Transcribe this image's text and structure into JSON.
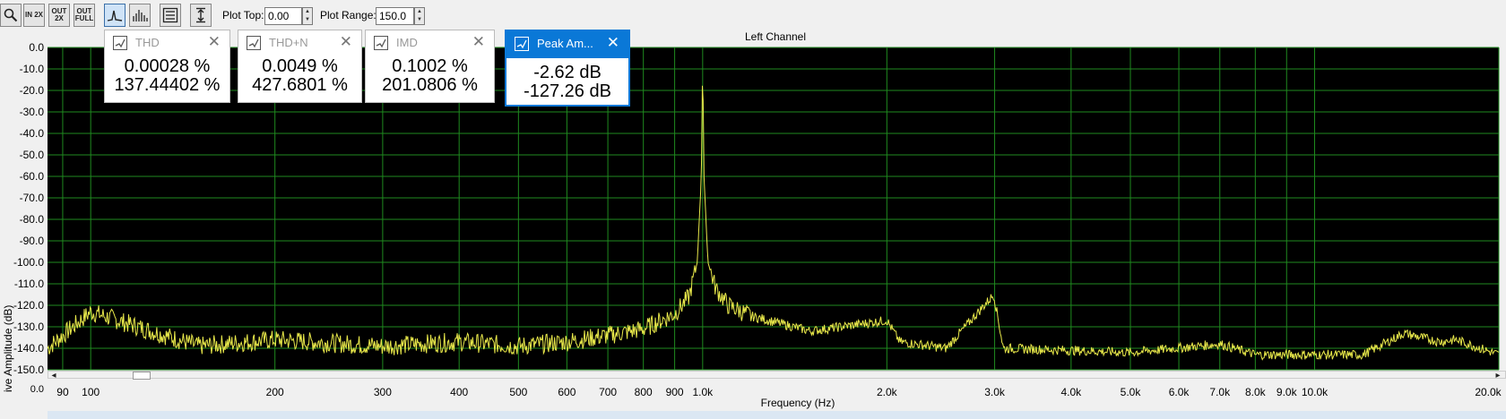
{
  "toolbar": {
    "buttons": [
      {
        "name": "zoom-button",
        "icon": "magnifier-icon",
        "label": ""
      },
      {
        "name": "zoom-in-2x-button",
        "icon": "zoom-in-2x-icon",
        "label": "IN 2X"
      },
      {
        "name": "zoom-out-2x-button",
        "icon": "zoom-out-2x-icon",
        "label": "OUT 2X"
      },
      {
        "name": "zoom-out-full-button",
        "icon": "zoom-out-full-icon",
        "label": "OUT FULL"
      },
      {
        "name": "line-plot-button",
        "icon": "line-plot-icon",
        "label": ""
      },
      {
        "name": "bar-plot-button",
        "icon": "bar-plot-icon",
        "label": ""
      },
      {
        "name": "settings-button",
        "icon": "list-settings-icon",
        "label": ""
      },
      {
        "name": "autoscale-button",
        "icon": "vertical-range-icon",
        "label": ""
      }
    ],
    "plot_top_label": "Plot Top:",
    "plot_top_value": "0.00",
    "plot_range_label": "Plot Range:",
    "plot_range_value": "150.0"
  },
  "channel_title": "Left Channel",
  "meters": [
    {
      "title": "THD",
      "value1": "0.00028 %",
      "value2": "137.44402 %",
      "active": false
    },
    {
      "title": "THD+N",
      "value1": "0.0049 %",
      "value2": "427.6801 %",
      "active": false
    },
    {
      "title": "IMD",
      "value1": "0.1002 %",
      "value2": "201.0806 %",
      "active": false
    },
    {
      "title": "Peak Am...",
      "value1": "-2.62 dB",
      "value2": "-127.26 dB",
      "active": true
    }
  ],
  "colors": {
    "plot_bg": "#000000",
    "grid": "#1f8a1f",
    "trace": "#e8e84a",
    "accent": "#0a78d7"
  },
  "chart_data": {
    "type": "line",
    "title": "Left Channel",
    "xlabel": "Frequency (Hz)",
    "ylabel": "ive Amplitude (dB)",
    "xscale": "log",
    "xlim": [
      85,
      20000
    ],
    "ylim": [
      -150,
      0
    ],
    "y_ticks": [
      "0.0",
      "-10.0",
      "-20.0",
      "-30.0",
      "-40.0",
      "-50.0",
      "-60.0",
      "-70.0",
      "-80.0",
      "-90.0",
      "-100.0",
      "-110.0",
      "-120.0",
      "-130.0",
      "-140.0",
      "-150.0"
    ],
    "x_ticks": [
      {
        "v": 90,
        "label": "90"
      },
      {
        "v": 100,
        "label": "100"
      },
      {
        "v": 200,
        "label": "200"
      },
      {
        "v": 300,
        "label": "300"
      },
      {
        "v": 400,
        "label": "400"
      },
      {
        "v": 500,
        "label": "500"
      },
      {
        "v": 600,
        "label": "600"
      },
      {
        "v": 700,
        "label": "700"
      },
      {
        "v": 800,
        "label": "800"
      },
      {
        "v": 900,
        "label": "900"
      },
      {
        "v": 1000,
        "label": "1.0k"
      },
      {
        "v": 2000,
        "label": "2.0k"
      },
      {
        "v": 3000,
        "label": "3.0k"
      },
      {
        "v": 4000,
        "label": "4.0k"
      },
      {
        "v": 5000,
        "label": "5.0k"
      },
      {
        "v": 6000,
        "label": "6.0k"
      },
      {
        "v": 7000,
        "label": "7.0k"
      },
      {
        "v": 8000,
        "label": "8.0k"
      },
      {
        "v": 9000,
        "label": "9.0k"
      },
      {
        "v": 10000,
        "label": "10.0k"
      },
      {
        "v": 20000,
        "label": "20.0k"
      }
    ],
    "scroll_label": "0.0",
    "series": [
      {
        "values": [
          [
            85,
            -140
          ],
          [
            100,
            -123
          ],
          [
            150,
            -139
          ],
          [
            200,
            -136
          ],
          [
            300,
            -139
          ],
          [
            400,
            -137
          ],
          [
            500,
            -139
          ],
          [
            600,
            -137
          ],
          [
            700,
            -134
          ],
          [
            800,
            -131
          ],
          [
            900,
            -124
          ],
          [
            950,
            -116
          ],
          [
            980,
            -100
          ],
          [
            995,
            -60
          ],
          [
            1000,
            -3
          ],
          [
            1005,
            -60
          ],
          [
            1020,
            -100
          ],
          [
            1050,
            -112
          ],
          [
            1100,
            -120
          ],
          [
            1200,
            -125
          ],
          [
            1500,
            -132
          ],
          [
            2000,
            -127
          ],
          [
            2100,
            -137
          ],
          [
            2500,
            -140
          ],
          [
            2990,
            -115
          ],
          [
            3100,
            -140
          ],
          [
            4000,
            -141
          ],
          [
            5000,
            -142
          ],
          [
            7000,
            -138
          ],
          [
            8000,
            -143
          ],
          [
            12000,
            -143
          ],
          [
            14000,
            -133
          ],
          [
            16000,
            -137
          ],
          [
            17000,
            -136
          ],
          [
            20000,
            -143
          ]
        ]
      }
    ]
  }
}
